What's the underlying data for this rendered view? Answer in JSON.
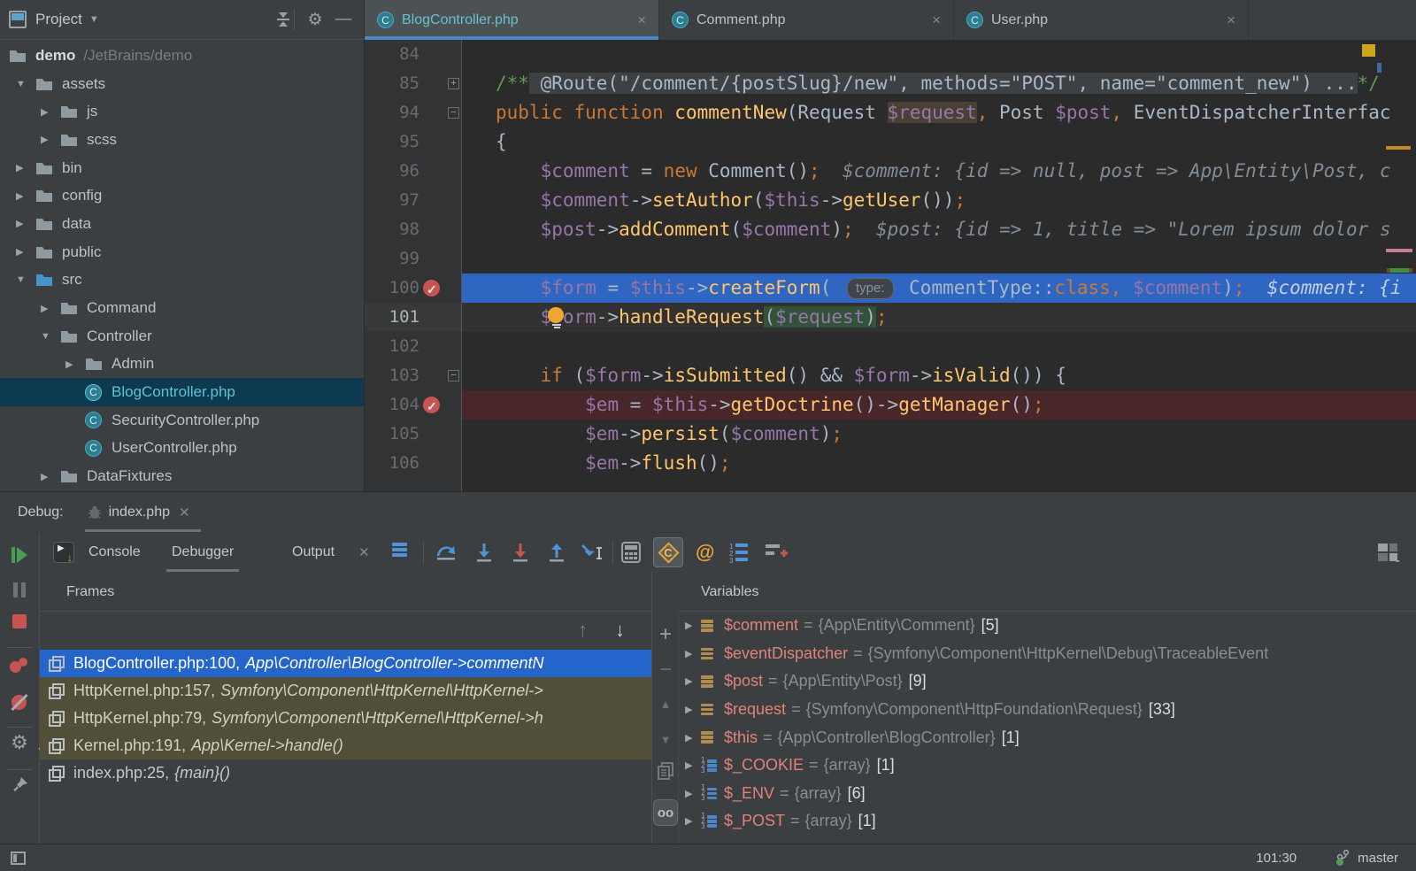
{
  "project": {
    "title": "Project",
    "tree": [
      {
        "label": "demo",
        "hint": "/JetBrains/demo",
        "icon": "folder",
        "level": 0,
        "arrow": null,
        "bold": true
      },
      {
        "label": "assets",
        "icon": "folder",
        "level": 1,
        "arrow": "down"
      },
      {
        "label": "js",
        "icon": "folder",
        "level": 2,
        "arrow": "right"
      },
      {
        "label": "scss",
        "icon": "folder",
        "level": 2,
        "arrow": "right"
      },
      {
        "label": "bin",
        "icon": "folder",
        "level": 1,
        "arrow": "right"
      },
      {
        "label": "config",
        "icon": "folder",
        "level": 1,
        "arrow": "right"
      },
      {
        "label": "data",
        "icon": "folder",
        "level": 1,
        "arrow": "right"
      },
      {
        "label": "public",
        "icon": "folder",
        "level": 1,
        "arrow": "right"
      },
      {
        "label": "src",
        "icon": "folder-src",
        "level": 1,
        "arrow": "down"
      },
      {
        "label": "Command",
        "icon": "folder",
        "level": 2,
        "arrow": "right"
      },
      {
        "label": "Controller",
        "icon": "folder",
        "level": 2,
        "arrow": "down"
      },
      {
        "label": "Admin",
        "icon": "folder",
        "level": 3,
        "arrow": "right"
      },
      {
        "label": "BlogController.php",
        "icon": "class",
        "level": 3,
        "arrow": null,
        "selected": true
      },
      {
        "label": "SecurityController.php",
        "icon": "class",
        "level": 3,
        "arrow": null
      },
      {
        "label": "UserController.php",
        "icon": "class",
        "level": 3,
        "arrow": null
      },
      {
        "label": "DataFixtures",
        "icon": "folder",
        "level": 2,
        "arrow": "right"
      }
    ]
  },
  "tabs": [
    {
      "label": "BlogController.php",
      "active": true
    },
    {
      "label": "Comment.php",
      "active": false
    },
    {
      "label": "User.php",
      "active": false
    }
  ],
  "editor": {
    "lines": [
      {
        "num": "84",
        "seg": []
      },
      {
        "num": "85",
        "fold": "plus",
        "seg": [
          {
            "s": "c",
            "t": "/**"
          },
          {
            "s": "fold",
            "t": " @Route(\"/comment/{postSlug}/new\", methods=\"POST\", name=\"comment_new\") ..."
          },
          {
            "s": "c",
            "t": "*/"
          }
        ]
      },
      {
        "num": "94",
        "fold": "minus",
        "seg": [
          {
            "s": "k",
            "t": "public function "
          },
          {
            "s": "f",
            "t": "commentNew"
          },
          {
            "s": "d",
            "t": "(Request "
          },
          {
            "s": "hl",
            "t": "$request"
          },
          {
            "s": "k",
            "t": ","
          },
          {
            "s": "d",
            "t": " Post "
          },
          {
            "s": "v",
            "t": "$post"
          },
          {
            "s": "k",
            "t": ","
          },
          {
            "s": "d",
            "t": " EventDispatcherInterfac"
          }
        ]
      },
      {
        "num": "95",
        "seg": [
          {
            "s": "d",
            "t": "{"
          }
        ]
      },
      {
        "num": "96",
        "seg": [
          {
            "s": "d",
            "t": "    "
          },
          {
            "s": "v",
            "t": "$comment"
          },
          {
            "s": "d",
            "t": " = "
          },
          {
            "s": "k",
            "t": "new "
          },
          {
            "s": "d",
            "t": "Comment()"
          },
          {
            "s": "k",
            "t": ";"
          },
          {
            "s": "h",
            "t": "  $comment: {id => null, post => App\\Entity\\Post, c"
          }
        ]
      },
      {
        "num": "97",
        "seg": [
          {
            "s": "d",
            "t": "    "
          },
          {
            "s": "v",
            "t": "$comment"
          },
          {
            "s": "d",
            "t": "->"
          },
          {
            "s": "f",
            "t": "setAuthor"
          },
          {
            "s": "d",
            "t": "("
          },
          {
            "s": "v",
            "t": "$this"
          },
          {
            "s": "d",
            "t": "->"
          },
          {
            "s": "f",
            "t": "getUser"
          },
          {
            "s": "d",
            "t": "())"
          },
          {
            "s": "k",
            "t": ";"
          }
        ]
      },
      {
        "num": "98",
        "seg": [
          {
            "s": "d",
            "t": "    "
          },
          {
            "s": "v",
            "t": "$post"
          },
          {
            "s": "d",
            "t": "->"
          },
          {
            "s": "f",
            "t": "addComment"
          },
          {
            "s": "d",
            "t": "("
          },
          {
            "s": "v",
            "t": "$comment"
          },
          {
            "s": "d",
            "t": ")"
          },
          {
            "s": "k",
            "t": ";"
          },
          {
            "s": "h",
            "t": "  $post: {id => 1, title => \"Lorem ipsum dolor s"
          }
        ]
      },
      {
        "num": "99",
        "seg": []
      },
      {
        "num": "100",
        "gutter": "bp",
        "hl": "exec",
        "seg": [
          {
            "s": "d",
            "t": "    "
          },
          {
            "s": "v",
            "t": "$form"
          },
          {
            "s": "d",
            "t": " = "
          },
          {
            "s": "v",
            "t": "$this"
          },
          {
            "s": "d",
            "t": "->"
          },
          {
            "s": "f",
            "t": "createForm"
          },
          {
            "s": "d",
            "t": "( "
          },
          {
            "s": "chip",
            "t": "type:"
          },
          {
            "s": "d",
            "t": " CommentType::"
          },
          {
            "s": "k",
            "t": "class"
          },
          {
            "s": "k",
            "t": ","
          },
          {
            "s": "d",
            "t": " "
          },
          {
            "s": "v",
            "t": "$comment"
          },
          {
            "s": "d",
            "t": ")"
          },
          {
            "s": "k",
            "t": ";"
          },
          {
            "s": "h",
            "t": "  $comment: {i"
          }
        ]
      },
      {
        "num": "101",
        "gutter": "bulb",
        "hl": "caret",
        "seg": [
          {
            "s": "d",
            "t": "    "
          },
          {
            "s": "v",
            "t": "$form"
          },
          {
            "s": "d",
            "t": "->"
          },
          {
            "s": "f",
            "t": "handleRequest"
          },
          {
            "s": "d sel",
            "t": "("
          },
          {
            "s": "v sel",
            "t": "$request"
          },
          {
            "s": "d sel",
            "t": ")"
          },
          {
            "s": "k",
            "t": ";"
          }
        ]
      },
      {
        "num": "102",
        "seg": []
      },
      {
        "num": "103",
        "fold": "minus",
        "seg": [
          {
            "s": "d",
            "t": "    "
          },
          {
            "s": "k",
            "t": "if"
          },
          {
            "s": "d",
            "t": " ("
          },
          {
            "s": "v",
            "t": "$form"
          },
          {
            "s": "d",
            "t": "->"
          },
          {
            "s": "f",
            "t": "isSubmitted"
          },
          {
            "s": "d",
            "t": "() && "
          },
          {
            "s": "v",
            "t": "$form"
          },
          {
            "s": "d",
            "t": "->"
          },
          {
            "s": "f",
            "t": "isValid"
          },
          {
            "s": "d",
            "t": "()) {"
          }
        ]
      },
      {
        "num": "104",
        "gutter": "bp",
        "hl": "bp",
        "seg": [
          {
            "s": "d",
            "t": "        "
          },
          {
            "s": "v",
            "t": "$em"
          },
          {
            "s": "d",
            "t": " = "
          },
          {
            "s": "v",
            "t": "$this"
          },
          {
            "s": "d",
            "t": "->"
          },
          {
            "s": "f",
            "t": "getDoctrine"
          },
          {
            "s": "d",
            "t": "()->"
          },
          {
            "s": "f",
            "t": "getManager"
          },
          {
            "s": "d",
            "t": "()"
          },
          {
            "s": "k",
            "t": ";"
          }
        ]
      },
      {
        "num": "105",
        "seg": [
          {
            "s": "d",
            "t": "        "
          },
          {
            "s": "v",
            "t": "$em"
          },
          {
            "s": "d",
            "t": "->"
          },
          {
            "s": "f",
            "t": "persist"
          },
          {
            "s": "d",
            "t": "("
          },
          {
            "s": "v",
            "t": "$comment"
          },
          {
            "s": "d",
            "t": ")"
          },
          {
            "s": "k",
            "t": ";"
          }
        ]
      },
      {
        "num": "106",
        "seg": [
          {
            "s": "d",
            "t": "        "
          },
          {
            "s": "v",
            "t": "$em"
          },
          {
            "s": "d",
            "t": "->"
          },
          {
            "s": "f",
            "t": "flush"
          },
          {
            "s": "d",
            "t": "()"
          },
          {
            "s": "k",
            "t": ";"
          }
        ]
      }
    ]
  },
  "debug": {
    "label": "Debug:",
    "session_tab": "index.php",
    "tabs": [
      "Console",
      "Debugger",
      "Output"
    ],
    "frames_title": "Frames",
    "variables_title": "Variables",
    "frames": [
      {
        "file": "BlogController.php:100,",
        "loc": "App\\Controller\\BlogController->commentN",
        "state": "selected"
      },
      {
        "file": "HttpKernel.php:157,",
        "loc": "Symfony\\Component\\HttpKernel\\HttpKernel->",
        "state": "library"
      },
      {
        "file": "HttpKernel.php:79,",
        "loc": "Symfony\\Component\\HttpKernel\\HttpKernel->h",
        "state": "library"
      },
      {
        "file": "Kernel.php:191,",
        "loc": "App\\Kernel->handle()",
        "state": "library"
      },
      {
        "file": "index.php:25,",
        "loc": "{main}()",
        "state": "normal"
      }
    ],
    "variables": [
      {
        "name": "$comment",
        "value": "{App\\Entity\\Comment}",
        "count": "[5]",
        "kind": "object"
      },
      {
        "name": "$eventDispatcher",
        "value": "{Symfony\\Component\\HttpKernel\\Debug\\TraceableEvent",
        "count": "",
        "kind": "object"
      },
      {
        "name": "$post",
        "value": "{App\\Entity\\Post}",
        "count": "[9]",
        "kind": "object"
      },
      {
        "name": "$request",
        "value": "{Symfony\\Component\\HttpFoundation\\Request}",
        "count": "[33]",
        "kind": "object"
      },
      {
        "name": "$this",
        "value": "{App\\Controller\\BlogController}",
        "count": "[1]",
        "kind": "object"
      },
      {
        "name": "$_COOKIE",
        "value": "{array}",
        "count": "[1]",
        "kind": "array"
      },
      {
        "name": "$_ENV",
        "value": "{array}",
        "count": "[6]",
        "kind": "array"
      },
      {
        "name": "$_POST",
        "value": "{array}",
        "count": "[1]",
        "kind": "array"
      }
    ]
  },
  "icons": {
    "php_console": "C",
    "mention": "@",
    "glasses": "oo"
  },
  "status": {
    "position": "101:30",
    "branch": "master"
  },
  "colors": {
    "accent_blue": "#4a88c5",
    "exec_line": "#2f66c1",
    "breakpoint": "#c75450",
    "selection": "#2365cb",
    "library_frame": "#514f38"
  }
}
